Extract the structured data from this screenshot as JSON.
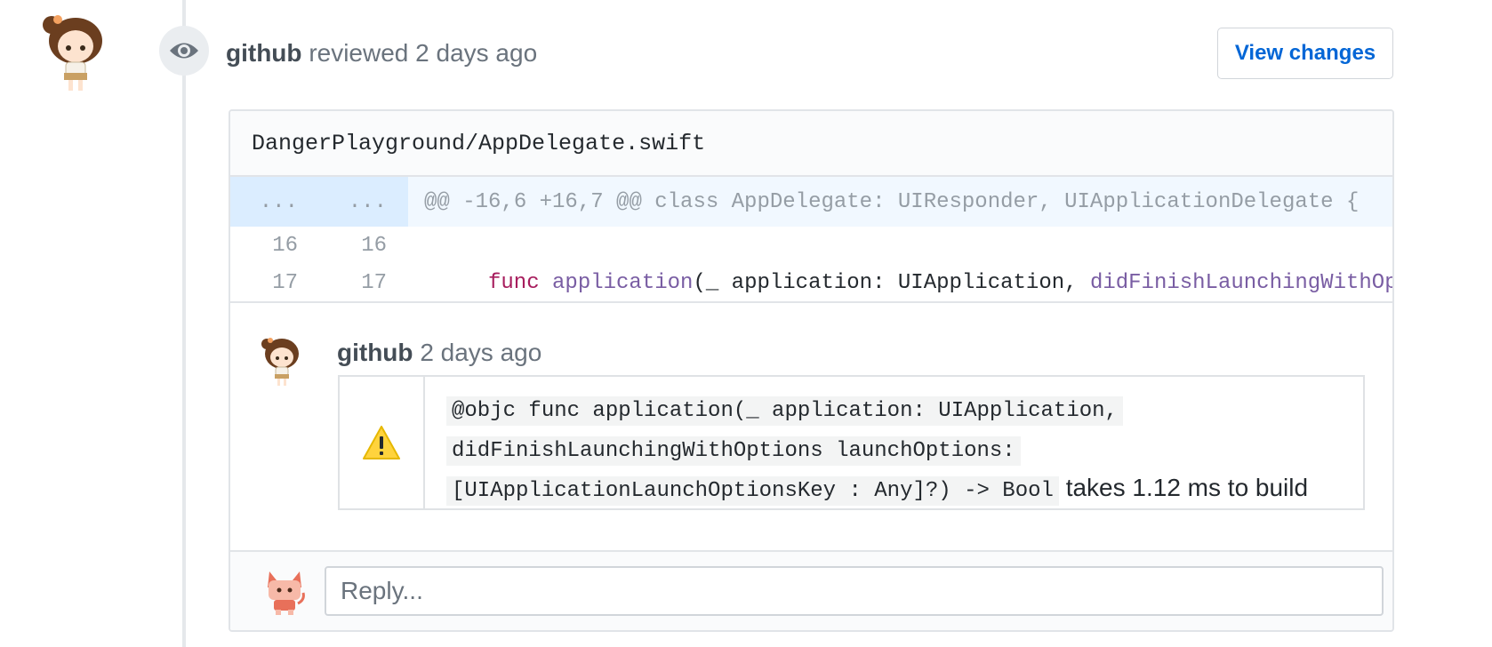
{
  "review": {
    "author": "github",
    "action": "reviewed 2 days ago",
    "view_changes_label": "View changes"
  },
  "file": {
    "path": "DangerPlayground/AppDelegate.swift"
  },
  "diff": {
    "hunk": {
      "old": "...",
      "new": "...",
      "text": "@@ -16,6 +16,7 @@ class AppDelegate: UIResponder, UIApplicationDelegate {"
    },
    "lines": [
      {
        "old": "16",
        "new": "16"
      },
      {
        "old": "17",
        "new": "17"
      }
    ],
    "line17": {
      "kw_func": "func",
      "fn_application": "application",
      "mid": "(_ application: UIApplication, ",
      "fn_did": "didFinishLaunchingWithOptions"
    }
  },
  "comment": {
    "author": "github",
    "time": "2 days ago",
    "code_line1": "@objc func application(_ application: UIApplication,",
    "code_line2": "didFinishLaunchingWithOptions launchOptions:",
    "code_line3": "[UIApplicationLaunchOptionsKey : Any]?) -> Bool",
    "suffix": "takes 1.12 ms to build"
  },
  "reply": {
    "placeholder": "Reply..."
  },
  "icons": {
    "review": "eye-icon",
    "warning": "warning-icon"
  },
  "colors": {
    "link": "#0366d6",
    "keyword": "#a71d5d",
    "function": "#795da3",
    "warning": "#ffd33d"
  }
}
